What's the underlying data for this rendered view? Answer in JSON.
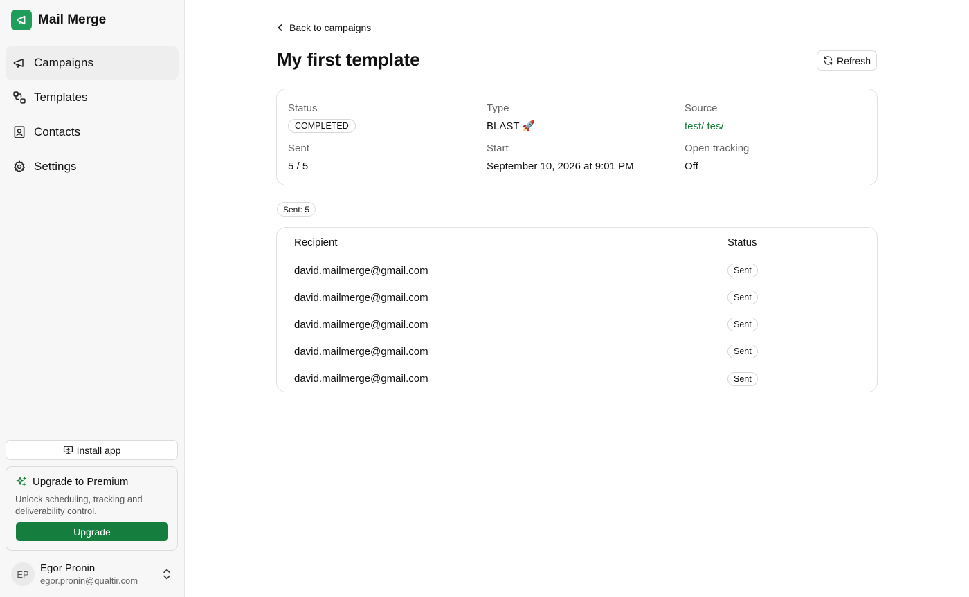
{
  "app": {
    "name": "Mail Merge"
  },
  "sidebar": {
    "items": [
      {
        "label": "Campaigns",
        "icon": "megaphone-icon",
        "active": true
      },
      {
        "label": "Templates",
        "icon": "templates-icon",
        "active": false
      },
      {
        "label": "Contacts",
        "icon": "contacts-icon",
        "active": false
      },
      {
        "label": "Settings",
        "icon": "gear-icon",
        "active": false
      }
    ],
    "install_label": "Install app",
    "premium": {
      "title": "Upgrade to Premium",
      "description": "Unlock scheduling, tracking and deliverability control.",
      "button_label": "Upgrade"
    },
    "user": {
      "initials": "EP",
      "name": "Egor Pronin",
      "email": "egor.pronin@qualtir.com"
    }
  },
  "header": {
    "back_label": "Back to campaigns",
    "title": "My first template",
    "refresh_label": "Refresh"
  },
  "summary": {
    "status_label": "Status",
    "status_value": "COMPLETED",
    "type_label": "Type",
    "type_value": "BLAST 🚀",
    "source_label": "Source",
    "source_value": "test/ tes/",
    "sent_label": "Sent",
    "sent_value": "5 / 5",
    "start_label": "Start",
    "start_value": "September 10, 2026 at 9:01 PM",
    "tracking_label": "Open tracking",
    "tracking_value": "Off"
  },
  "sent_count_badge": "Sent: 5",
  "table": {
    "columns": [
      "Recipient",
      "Status"
    ],
    "rows": [
      {
        "recipient": "david.mailmerge@gmail.com",
        "status": "Sent"
      },
      {
        "recipient": "david.mailmerge@gmail.com",
        "status": "Sent"
      },
      {
        "recipient": "david.mailmerge@gmail.com",
        "status": "Sent"
      },
      {
        "recipient": "david.mailmerge@gmail.com",
        "status": "Sent"
      },
      {
        "recipient": "david.mailmerge@gmail.com",
        "status": "Sent"
      }
    ]
  },
  "colors": {
    "brand": "#1e9e5a",
    "upgrade_button": "#157e3f",
    "source_link": "#1a7f3c",
    "sidebar_bg": "#f7f7f7"
  }
}
